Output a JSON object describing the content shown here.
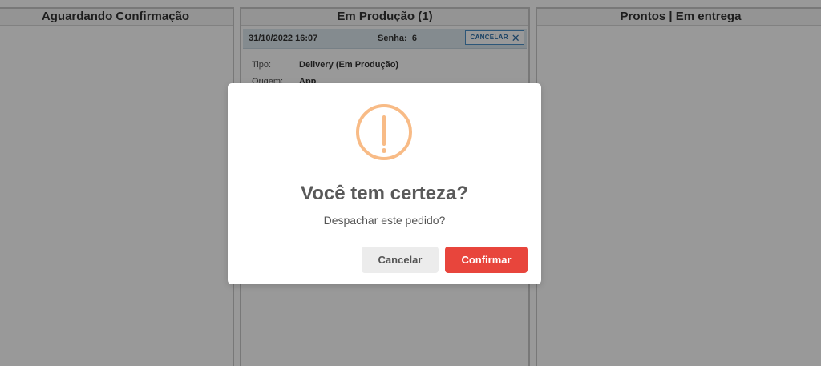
{
  "columns": [
    {
      "title": "Aguardando Confirmação"
    },
    {
      "title": "Em Produção (1)"
    },
    {
      "title": "Prontos | Em entrega"
    }
  ],
  "order": {
    "datetime": "31/10/2022 16:07",
    "password_label": "Senha:",
    "password_value": "6",
    "cancel_label": "CANCELAR",
    "fields": [
      {
        "key": "Tipo:",
        "value": "Delivery (Em Produção)"
      },
      {
        "key": "Origem:",
        "value": "App"
      }
    ]
  },
  "dialog": {
    "title": "Você tem certeza?",
    "message": "Despachar este pedido?",
    "cancel_label": "Cancelar",
    "confirm_label": "Confirmar",
    "icon": "warning-icon"
  },
  "colors": {
    "overlay": "rgba(0,0,0,0.4)",
    "warning": "#f8bb86",
    "confirm": "#e8453c",
    "cancel": "#ececec"
  }
}
